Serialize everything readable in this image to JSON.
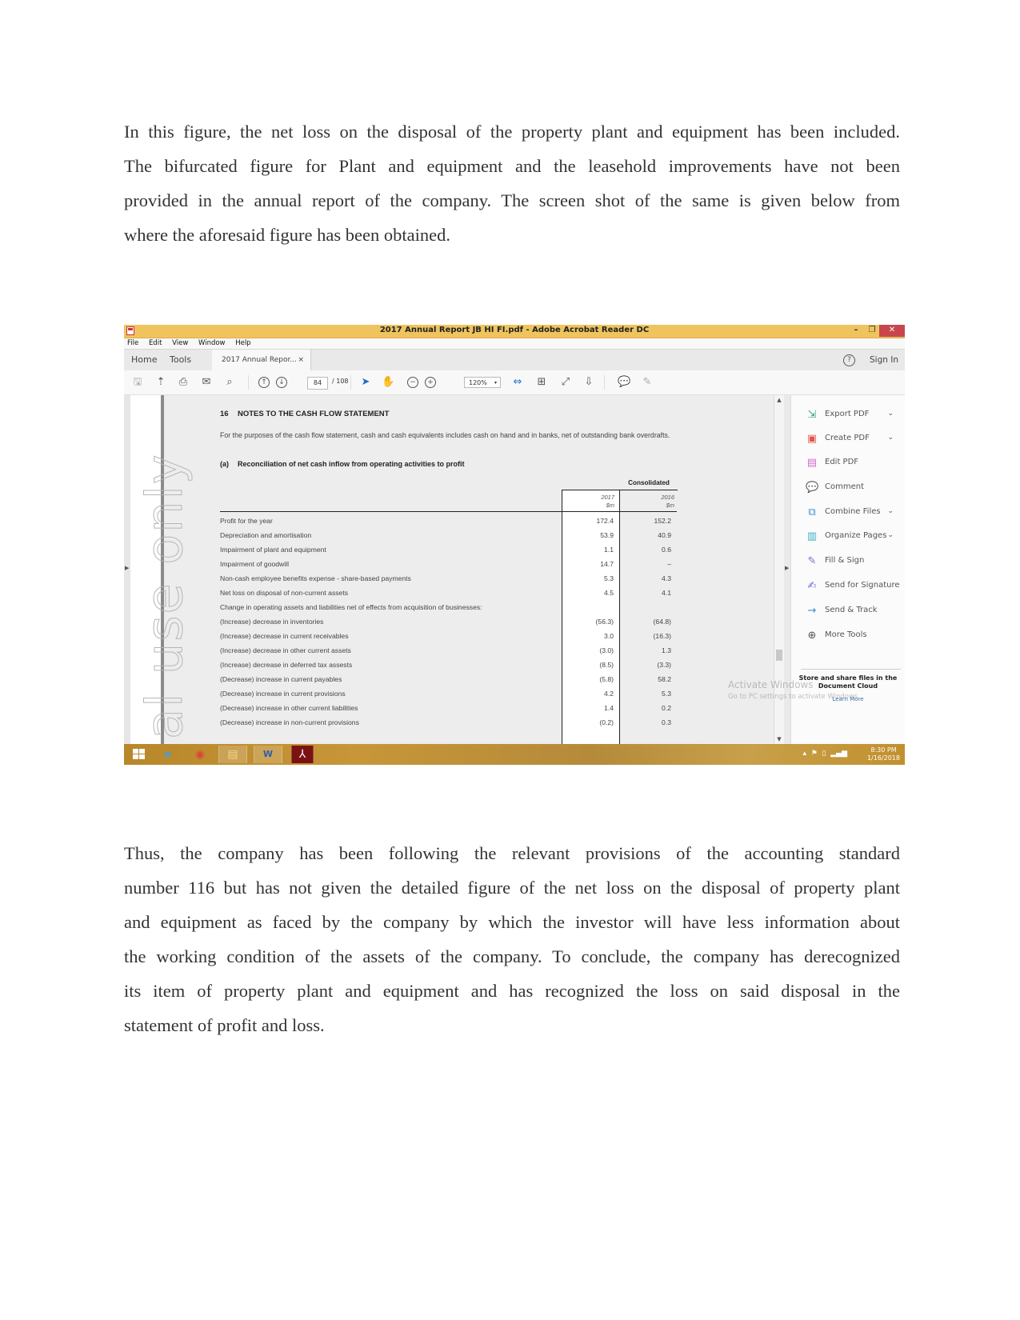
{
  "paragraph_top": {
    "lines": [
      "In this figure, the net loss on the disposal of the property plant and equipment has been included.",
      "The bifurcated figure for Plant and equipment and the leasehold improvements have not been",
      "provided in the annual report of the company. The screen shot of the same is given below from",
      "where the aforesaid figure has been obtained."
    ]
  },
  "paragraph_bottom": {
    "lines": [
      "Thus, the company has been following the relevant provisions of the accounting standard",
      "number 116 but has not given the detailed figure of the net loss on the disposal of property plant",
      "and equipment as faced by the company by which the investor will have less information about",
      "the working condition of the assets of the company. To conclude, the company has derecognized",
      "its item of property plant and equipment and has recognized the loss on said disposal in the",
      "statement of profit and loss."
    ]
  },
  "screenshot": {
    "window_title": "2017 Annual Report JB HI FI.pdf - Adobe Acrobat Reader DC",
    "window_controls": {
      "minimize": "–",
      "maximize": "❐",
      "close": "✕"
    },
    "menu": [
      "File",
      "Edit",
      "View",
      "Window",
      "Help"
    ],
    "tabs": {
      "home": "Home",
      "tools": "Tools",
      "document": "2017 Annual Repor...",
      "close": "×"
    },
    "help_icon": "?",
    "sign_in": "Sign In",
    "toolbar": {
      "page_current": "84",
      "page_total": "/ 108",
      "zoom": "120%",
      "zoom_caret": "▾"
    },
    "watermark": "al use only",
    "document": {
      "heading_number": "16",
      "heading": "NOTES TO THE CASH FLOW STATEMENT",
      "intro": "For the purposes of the cash flow statement, cash and cash equivalents includes cash on hand and in banks, net of outstanding bank overdrafts.",
      "sub_label": "(a)",
      "sub_heading": "Reconciliation of net cash inflow from operating activities to profit",
      "group_header": "Consolidated",
      "columns": [
        {
          "year": "2017",
          "unit": "$m"
        },
        {
          "year": "2016",
          "unit": "$m"
        }
      ],
      "rows": [
        {
          "label": "Profit for the year",
          "v2017": "172.4",
          "v2016": "152.2"
        },
        {
          "label": "Depreciation and amortisation",
          "v2017": "53.9",
          "v2016": "40.9"
        },
        {
          "label": "Impairment of plant and equipment",
          "v2017": "1.1",
          "v2016": "0.6"
        },
        {
          "label": "Impairment of goodwill",
          "v2017": "14.7",
          "v2016": "–"
        },
        {
          "label": "Non-cash employee benefits expense - share-based payments",
          "v2017": "5.3",
          "v2016": "4.3"
        },
        {
          "label": "Net loss on disposal of non-current assets",
          "v2017": "4.5",
          "v2016": "4.1"
        },
        {
          "label": "Change in operating assets and liabilities net of effects from acquisition of businesses:",
          "v2017": "",
          "v2016": ""
        },
        {
          "label": "(Increase) decrease in inventories",
          "v2017": "(56.3)",
          "v2016": "(64.8)"
        },
        {
          "label": "(Increase) decrease in current receivables",
          "v2017": "3.0",
          "v2016": "(16.3)"
        },
        {
          "label": "(Increase) decrease in other current assets",
          "v2017": "(3.0)",
          "v2016": "1.3"
        },
        {
          "label": "(Increase) decrease in deferred tax assests",
          "v2017": "(8.5)",
          "v2016": "(3.3)"
        },
        {
          "label": "(Decrease) increase in current payables",
          "v2017": "(5.8)",
          "v2016": "58.2"
        },
        {
          "label": "(Decrease) increase in current provisions",
          "v2017": "4.2",
          "v2016": "5.3"
        },
        {
          "label": "(Decrease) increase in other current liabilities",
          "v2017": "1.4",
          "v2016": "0.2"
        },
        {
          "label": "(Decrease) increase in non-current provisions",
          "v2017": "(0.2)",
          "v2016": "0.3"
        }
      ]
    },
    "tool_pane": {
      "items": [
        {
          "label": "Export PDF",
          "icon": "export-pdf-icon",
          "glyph": "⇲",
          "color": "#3aa67a",
          "chevron": "⌄"
        },
        {
          "label": "Create PDF",
          "icon": "create-pdf-icon",
          "glyph": "▣",
          "color": "#e0554e",
          "chevron": "⌄"
        },
        {
          "label": "Edit PDF",
          "icon": "edit-pdf-icon",
          "glyph": "▤",
          "color": "#d46bc8",
          "chevron": ""
        },
        {
          "label": "Comment",
          "icon": "comment-icon",
          "glyph": "💬",
          "color": "#f0c64a",
          "chevron": ""
        },
        {
          "label": "Combine Files",
          "icon": "combine-files-icon",
          "glyph": "⧉",
          "color": "#3a8fd0",
          "chevron": "⌄"
        },
        {
          "label": "Organize Pages",
          "icon": "organize-pages-icon",
          "glyph": "▥",
          "color": "#3ab3c7",
          "chevron": "⌄"
        },
        {
          "label": "Fill & Sign",
          "icon": "fill-sign-icon",
          "glyph": "✎",
          "color": "#7b6fd0",
          "chevron": ""
        },
        {
          "label": "Send for Signature",
          "icon": "send-signature-icon",
          "glyph": "✍",
          "color": "#6a6fd6",
          "chevron": ""
        },
        {
          "label": "Send & Track",
          "icon": "send-track-icon",
          "glyph": "→",
          "color": "#2f8fd6",
          "chevron": ""
        },
        {
          "label": "More Tools",
          "icon": "more-tools-icon",
          "glyph": "⊕",
          "color": "#555555",
          "chevron": ""
        }
      ],
      "cloud_line1": "Store and share files in the",
      "cloud_line2": "Document Cloud",
      "learn_more": "Learn More"
    },
    "activate_windows": {
      "title": "Activate Windows",
      "subtitle": "Go to PC settings to activate Windows."
    },
    "taskbar": {
      "time": "8:30 PM",
      "date": "1/16/2018",
      "tray_up": "▴"
    }
  }
}
